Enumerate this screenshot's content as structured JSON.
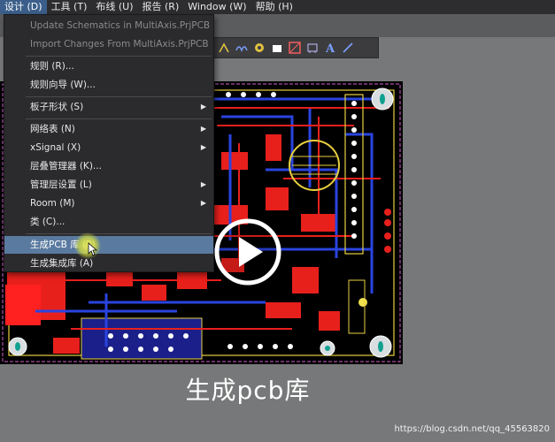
{
  "menubar": {
    "items": [
      "设计 (D)",
      "工具 (T)",
      "布线 (U)",
      "报告 (R)",
      "Window (W)",
      "帮助 (H)"
    ]
  },
  "menu": {
    "items": [
      "Update Schematics in MultiAxis.PrjPCB",
      "Import Changes From MultiAxis.PrjPCB",
      "规则 (R)...",
      "规则向导 (W)...",
      "板子形状 (S)",
      "网络表 (N)",
      "xSignal (X)",
      "层叠管理器 (K)...",
      "管理层设置 (L)",
      "Room (M)",
      "类 (C)...",
      "生成PCB 库 (P)",
      "生成集成库 (A)"
    ]
  },
  "video": {
    "caption": "生成pcb库",
    "watermark": "https://blog.csdn.net/qq_45563820"
  },
  "colors": {
    "menubar_bg": "#2d2d30",
    "menu_bg": "#2b2b2e",
    "highlight": "#5a7aa0",
    "pcb_red": "#e8201c",
    "pcb_blue": "#2a44e0",
    "pcb_yellow": "#f0e050"
  },
  "icons": [
    "play-icon",
    "arrow-icon",
    "text-icon",
    "line-icon",
    "mouse-cursor-icon"
  ]
}
